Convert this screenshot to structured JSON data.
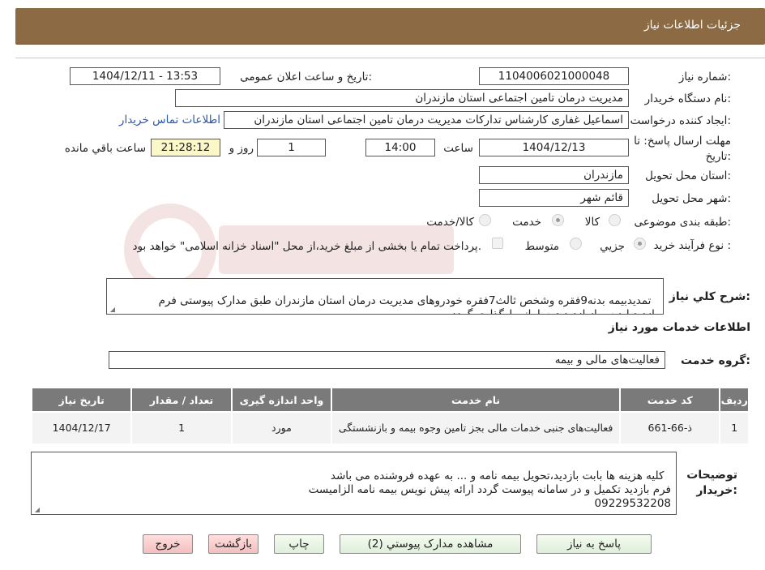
{
  "header": {
    "title": "جزئیات اطلاعات نیاز"
  },
  "form": {
    "need_number": {
      "label": "شماره نیاز:",
      "value": "1104006021000048"
    },
    "announce": {
      "label": "تاریخ و ساعت اعلان عمومی:",
      "value": "1404/12/11 - 13:53"
    },
    "buyer": {
      "label": "نام دستگاه خریدار:",
      "value": "مدیریت درمان تامین اجتماعی استان مازندران"
    },
    "creator": {
      "label": "ایجاد کننده درخواست:",
      "value": "اسماعیل غفاری کارشناس تدارکات مدیریت درمان تامین اجتماعی استان مازندران",
      "contact_link": "اطلاعات تماس خریدار"
    },
    "deadline": {
      "label": "مهلت ارسال پاسخ: تا تاریخ:",
      "date": "1404/12/13",
      "time_label": "ساعت",
      "time": "14:00",
      "days": "1",
      "days_label": "روز و",
      "remaining": "21:28:12",
      "remaining_label": "ساعت باقي مانده"
    },
    "province": {
      "label": "استان محل تحویل:",
      "value": "مازندران"
    },
    "city": {
      "label": "شهر محل تحویل:",
      "value": "قائم شهر"
    },
    "category": {
      "label": "طبقه بندی موضوعی:",
      "options": [
        "کالا",
        "خدمت",
        "کالا/خدمت"
      ],
      "selected": "خدمت"
    },
    "process": {
      "label": "نوع فرآیند خرید :",
      "options": [
        "جزیي",
        "متوسط"
      ],
      "selected": "جزیي",
      "note": "پرداخت تمام یا بخشی از مبلغ خرید،از محل \"اسناد خزانه اسلامی\" خواهد بود."
    },
    "description": {
      "label": "شرح کلي نیاز:",
      "value": "تمدیدبیمه بدنه9فقره وشخص ثالث7فقره خودروهای مدیریت درمان استان مازندران طبق مدارک پیوستی فرم بازدیدبایدپس ازبازدید،درسامانه بارگذاری گردد"
    }
  },
  "services": {
    "section_title": "اطلاعات خدمات مورد نیاز",
    "group_label": "گروه خدمت:",
    "group_value": "فعالیت‌های مالی و بیمه",
    "columns": [
      "ردیف",
      "کد خدمت",
      "نام خدمت",
      "واحد اندازه گیری",
      "تعداد / مقدار",
      "تاریخ نیاز"
    ],
    "rows": [
      {
        "row": "1",
        "code": "ذ-66-661",
        "name": "فعالیت‌های جنبی خدمات مالی بجز تامین وجوه بیمه و بازنشستگی",
        "unit": "مورد",
        "qty": "1",
        "date": "1404/12/17"
      }
    ]
  },
  "buyer_notes": {
    "label": "توضیحات خریدار:",
    "value": "کلیه هزینه ها بابت بازدید،تحویل بیمه نامه و ... به عهده فروشنده می باشد\nفرم بازدید تکمیل و در سامانه پیوست گردد ارائه پیش نویس بیمه نامه الزامیست\n09229532208"
  },
  "buttons": {
    "reply": "پاسخ به نیاز",
    "attachments": "مشاهده مدارک پیوستي (2)",
    "print": "چاپ",
    "back": "بازگشت",
    "exit": "خروج"
  },
  "colors": {
    "header_bg": "#8c6a43",
    "table_header_bg": "#7a7a7a",
    "timer_bg": "#fcf7c8",
    "exit_bg": "#f3bfbf",
    "button_bg": "#dfeeda",
    "link": "#2a57b0"
  }
}
